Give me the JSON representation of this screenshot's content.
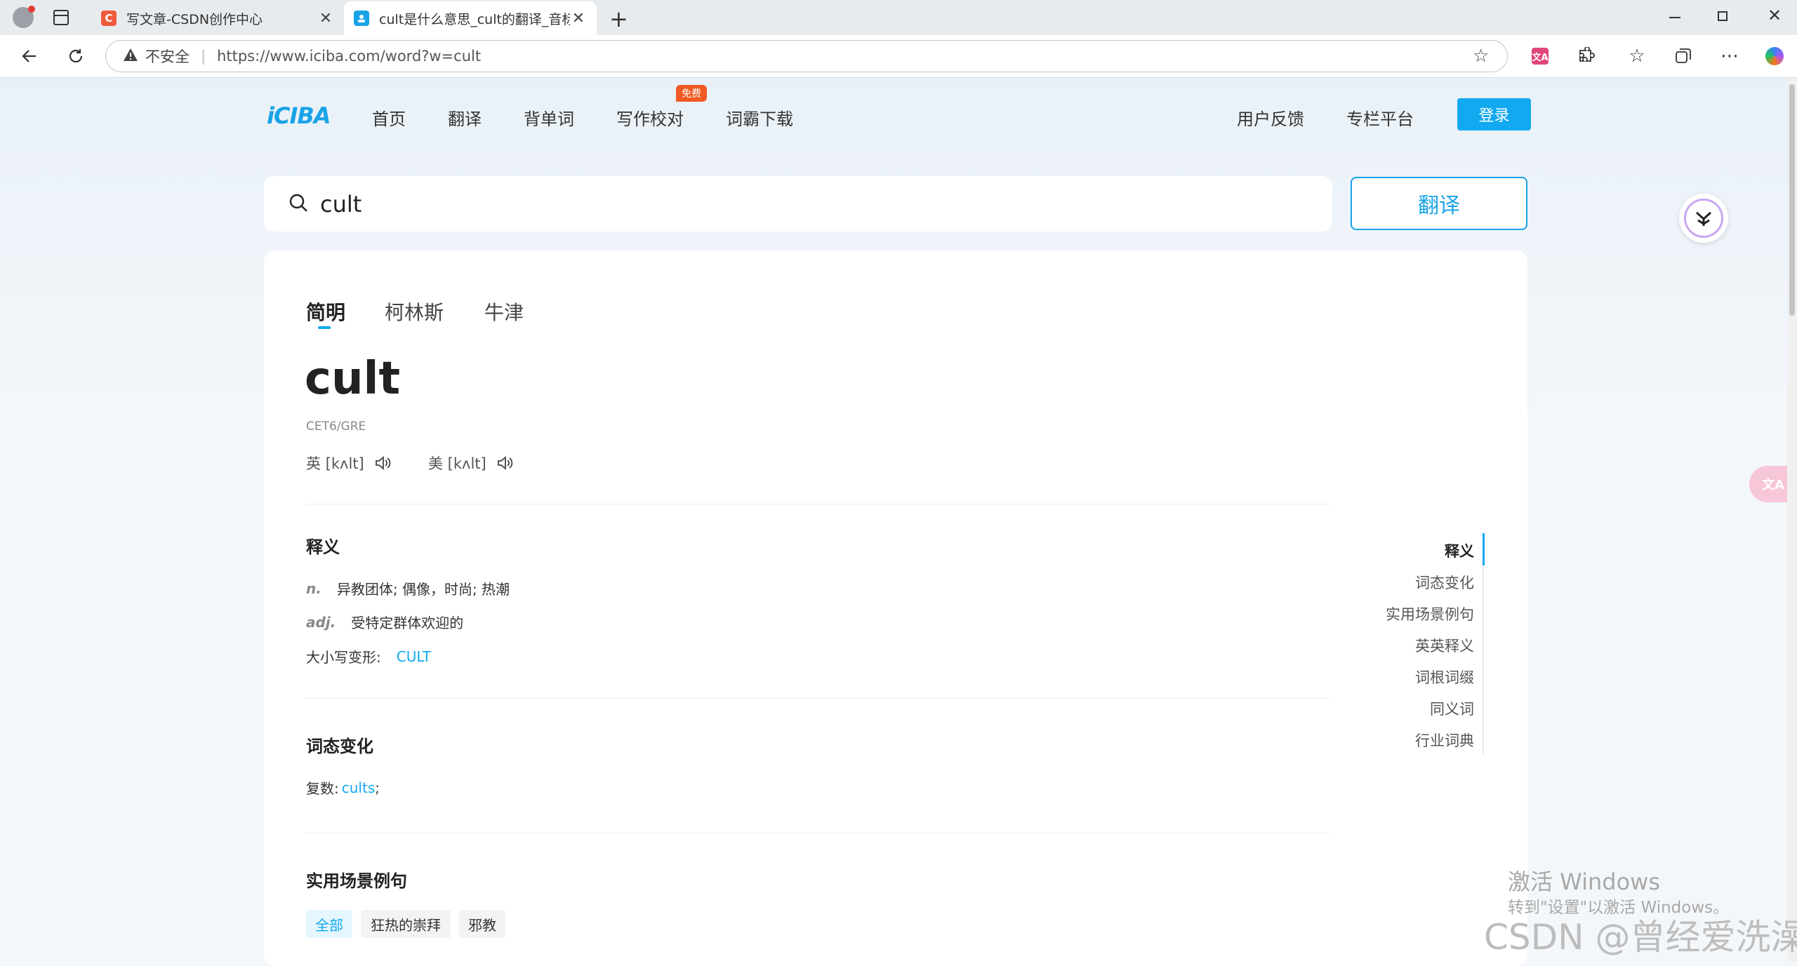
{
  "browser": {
    "tabs": [
      {
        "title": "写文章-CSDN创作中心",
        "favicon": "C"
      },
      {
        "title": "cult是什么意思_cult的翻译_音标_读音_用法_例句_爱词霸在线词典"
      }
    ],
    "security_label": "不安全",
    "url": "https://www.iciba.com/word?w=cult"
  },
  "site": {
    "logo": "iCIBA",
    "nav": [
      "首页",
      "翻译",
      "背单词",
      "写作校对",
      "词霸下载"
    ],
    "free_badge": "免费",
    "right_nav": [
      "用户反馈",
      "专栏平台"
    ],
    "login": "登录",
    "accent_color": "#13a9f0"
  },
  "search": {
    "value": "cult",
    "button": "翻译"
  },
  "dict_tabs": [
    "简明",
    "柯林斯",
    "牛津"
  ],
  "entry": {
    "word": "cult",
    "tags": "CET6/GRE",
    "pron_uk": "英 [kʌlt]",
    "pron_us": "美 [kʌlt]",
    "definitions_title": "释义",
    "definitions": [
      {
        "pos": "n.",
        "text": "异教团体; 偶像，时尚; 热潮"
      },
      {
        "pos": "adj.",
        "text": "受特定群体欢迎的"
      }
    ],
    "case_label": "大小写变形:",
    "case_value": "CULT",
    "inflection_title": "词态变化",
    "plural_label": "复数:",
    "plural_value": "cults",
    "plural_suffix": ";",
    "examples_title": "实用场景例句",
    "example_filters": [
      "全部",
      "狂热的崇拜",
      "邪教"
    ]
  },
  "side_nav": [
    "释义",
    "词态变化",
    "实用场景例句",
    "英英释义",
    "词根词缀",
    "同义词",
    "行业词典"
  ],
  "watermark": {
    "line1": "激活 Windows",
    "line2": "转到\"设置\"以激活 Windows。",
    "csdn": "CSDN @曾经爱洗澡"
  }
}
